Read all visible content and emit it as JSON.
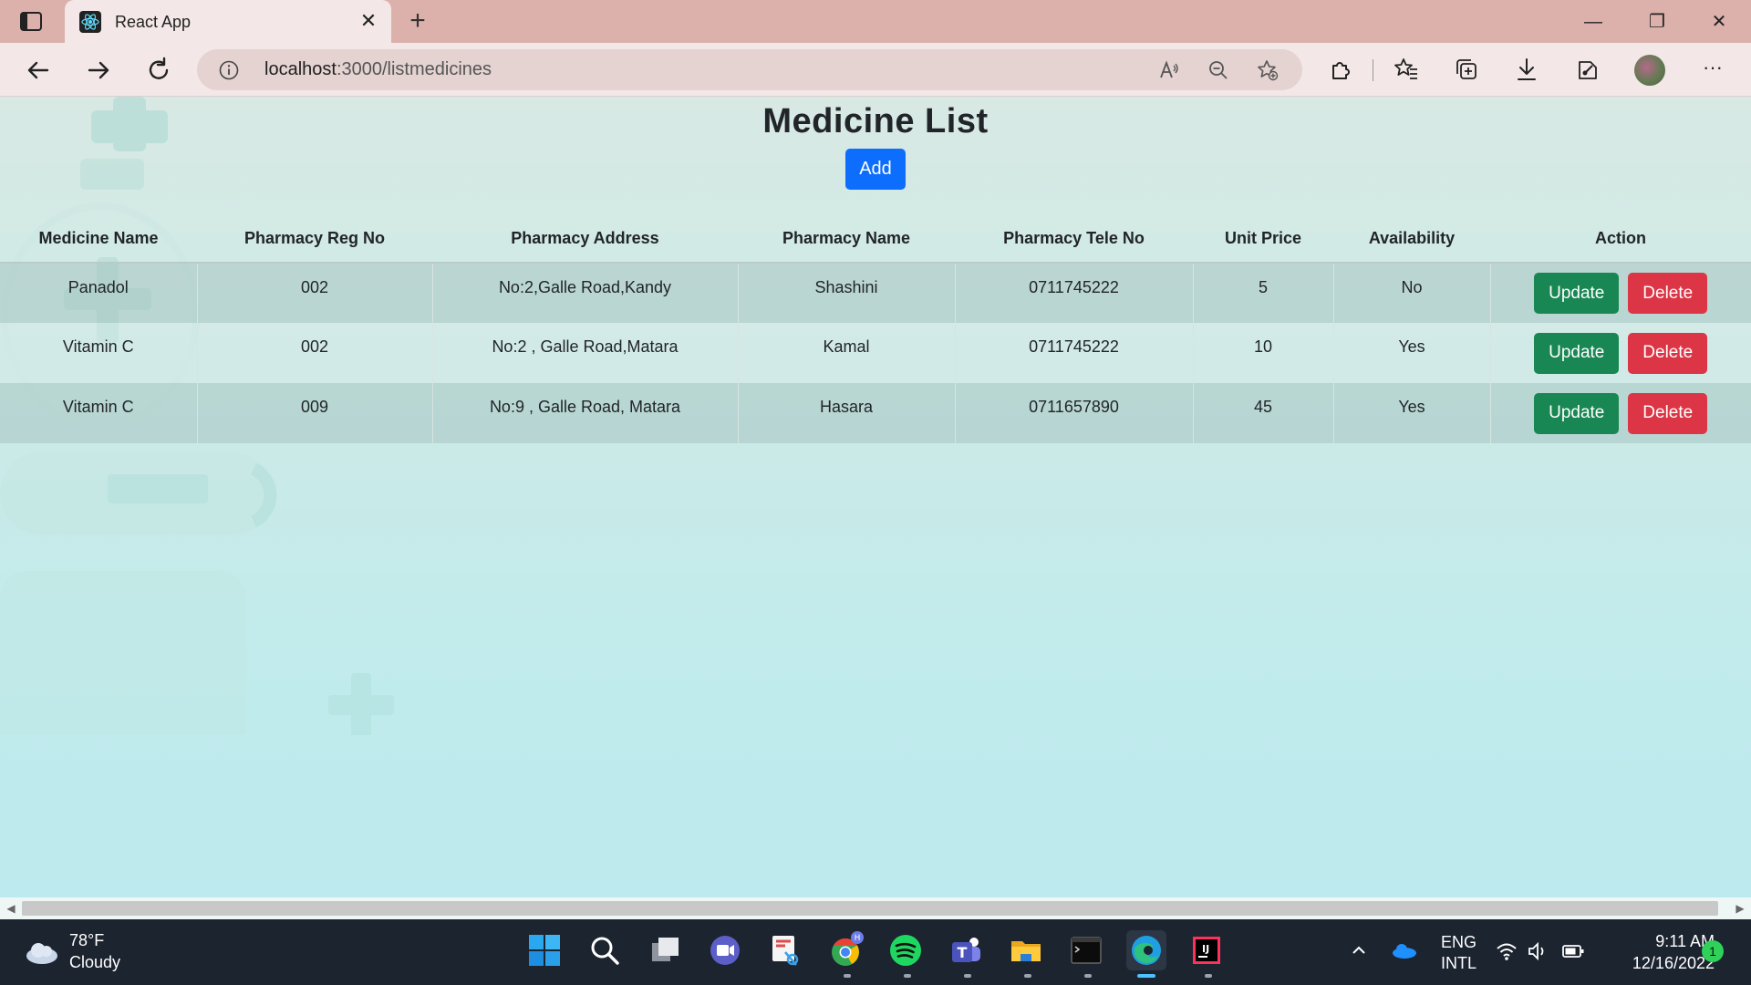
{
  "browser": {
    "tab_title": "React App",
    "url_host": "localhost",
    "url_path": ":3000/listmedicines"
  },
  "page": {
    "title": "Medicine List",
    "add_label": "Add"
  },
  "table": {
    "headers": [
      "Medicine Name",
      "Pharmacy Reg No",
      "Pharmacy Address",
      "Pharmacy Name",
      "Pharmacy Tele No",
      "Unit Price",
      "Availability",
      "Action"
    ],
    "rows": [
      {
        "medicine": "Panadol",
        "reg_no": "002",
        "address": "No:2,Galle Road,Kandy",
        "pharmacy": "Shashini",
        "tele": "0711745222",
        "price": "5",
        "availability": "No"
      },
      {
        "medicine": "Vitamin C",
        "reg_no": "002",
        "address": "No:2 , Galle Road,Matara",
        "pharmacy": "Kamal",
        "tele": "0711745222",
        "price": "10",
        "availability": "Yes"
      },
      {
        "medicine": "Vitamin C",
        "reg_no": "009",
        "address": "No:9 , Galle Road, Matara",
        "pharmacy": "Hasara",
        "tele": "0711657890",
        "price": "45",
        "availability": "Yes"
      }
    ],
    "update_label": "Update",
    "delete_label": "Delete"
  },
  "taskbar": {
    "weather_temp": "78°F",
    "weather_desc": "Cloudy",
    "lang_line1": "ENG",
    "lang_line2": "INTL",
    "time": "9:11 AM",
    "date": "12/16/2022",
    "notification_count": "1"
  },
  "colors": {
    "primary": "#0d6efd",
    "success": "#198754",
    "danger": "#dc3545",
    "titlebar": "#dcb0ab",
    "taskbar": "#1c2430"
  }
}
